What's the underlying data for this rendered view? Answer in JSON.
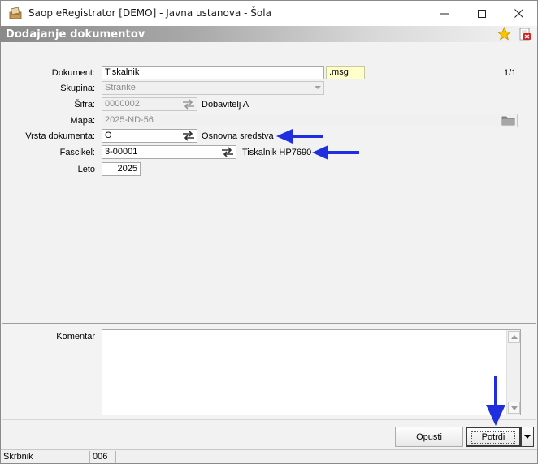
{
  "window": {
    "title": "Saop eRegistrator [DEMO] - Javna ustanova - Šola"
  },
  "header": {
    "title": "Dodajanje dokumentov"
  },
  "form": {
    "counter": "1/1",
    "dokument": {
      "label": "Dokument:",
      "value": "Tiskalnik",
      "extension": ".msg"
    },
    "skupina": {
      "label": "Skupina:",
      "value": "Stranke"
    },
    "sifra": {
      "label": "Šifra:",
      "value": "0000002",
      "description": "Dobavitelj A"
    },
    "mapa": {
      "label": "Mapa:",
      "value": "2025-ND-56"
    },
    "vrsta": {
      "label": "Vrsta dokumenta:",
      "value": "O",
      "description": "Osnovna sredstva"
    },
    "fascikel": {
      "label": "Fascikel:",
      "value": "3-00001",
      "description": "Tiskalnik HP7690"
    },
    "leto": {
      "label": "Leto",
      "value": "2025"
    }
  },
  "comment": {
    "label": "Komentar",
    "value": ""
  },
  "buttons": {
    "cancel": "Opusti",
    "confirm": "Potrdi"
  },
  "statusbar": {
    "user": "Skrbnik",
    "code": "006"
  },
  "colors": {
    "accent_arrow": "#1f2fe0",
    "header_gradient_start": "#8a8a8a",
    "star": "#f5c400"
  },
  "icons": [
    "app-icon",
    "minimize-icon",
    "maximize-icon",
    "close-icon",
    "star-icon",
    "close-document-icon",
    "swap-arrows-icon",
    "folder-icon",
    "chevron-down-icon",
    "pointer-arrow-icon"
  ]
}
